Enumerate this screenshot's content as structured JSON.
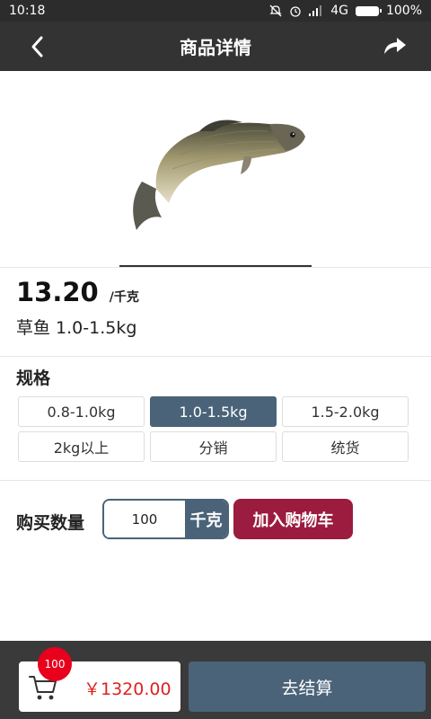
{
  "status_bar": {
    "time": "10:18",
    "network": "4G",
    "battery": "100%",
    "battery_level": 1.0
  },
  "header": {
    "title": "商品详情",
    "back_icon": "chevron-left-icon",
    "share_icon": "share-arrow-icon"
  },
  "product": {
    "price": "13.20",
    "unit": "/千克",
    "name": "草鱼 1.0-1.5kg",
    "image": "grass-carp-fish"
  },
  "specs": {
    "title": "规格",
    "options": [
      "0.8-1.0kg",
      "1.0-1.5kg",
      "1.5-2.0kg",
      "2kg以上",
      "分销",
      "统货"
    ],
    "selected": "1.0-1.5kg"
  },
  "quantity": {
    "label": "购买数量",
    "value": "100",
    "unit": "千克",
    "add_to_cart": "加入购物车"
  },
  "bottom": {
    "cart_count": "100",
    "total": "￥1320.00",
    "checkout": "去结算"
  },
  "colors": {
    "accent": "#4a6378",
    "cart_button": "#9b1c3f",
    "badge": "#e8001c",
    "header": "#333333",
    "price_red": "#e02020"
  }
}
